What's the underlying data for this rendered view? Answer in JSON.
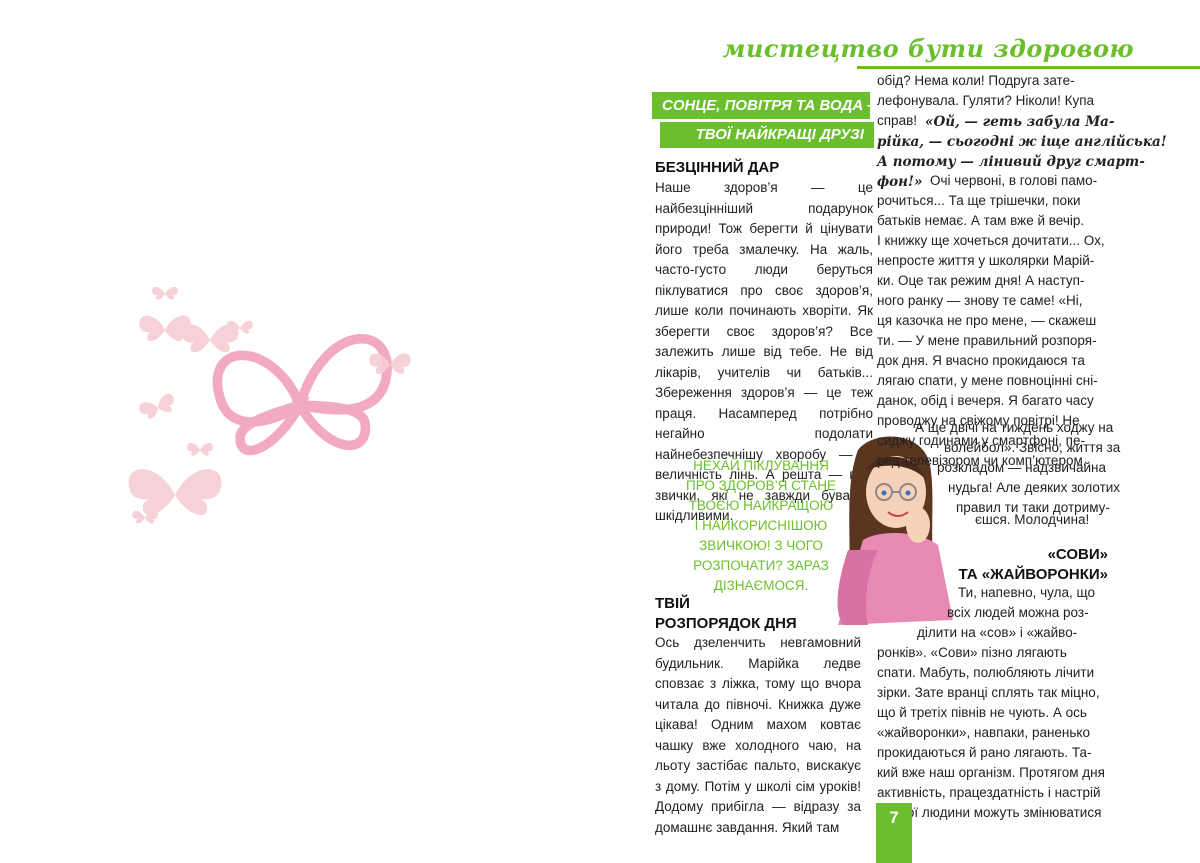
{
  "header": {
    "title": "мистецтво бути здоровою"
  },
  "banner": {
    "line1": "СОНЦЕ, ПОВІТРЯ ТА ВОДА —",
    "line2": "ТВОЇ НАЙКРАЩІ ДРУЗІ"
  },
  "section1": {
    "heading": "БЕЗЦІННИЙ ДАР",
    "text": "Наше здоров’я — це найбезцінніший подарунок природи! Тож берегти й цінувати його треба змалечку. На жаль, часто-густо люди беруться піклуватися про своє здоров’я, лише коли починають хворіти. Як зберегти своє здоров’я? Все залежить лише від тебе. Не від лікарів, учителів чи батьків... Збереження здоров’я — це теж праця. Насамперед потрібно негайно подолати найнебезпечнішу хворобу — її величність лінь. А решта — вже звички, які не завжди бувають шкідливими."
  },
  "callout": {
    "lines": [
      "НЕХАЙ ПІКЛУВАННЯ",
      "ПРО ЗДОРОВ’Я СТАНЕ",
      "ТВОЄЮ НАЙКРАЩОЮ",
      "І НАЙКОРИСНІШОЮ",
      "ЗВИЧКОЮ! З ЧОГО",
      "РОЗПОЧАТИ? ЗАРАЗ",
      "ДІЗНАЄМОСЯ."
    ]
  },
  "section2": {
    "heading_line1": "ТВІЙ",
    "heading_line2": "РОЗПОРЯДОК ДНЯ",
    "text": "Ось дзеленчить невгамовний будильник. Марійка ледве сповзає з ліжка, тому що вчора читала до півночі. Книжка дуже цікава! Одним махом ковтає чашку вже холодного чаю, на льоту застібає пальто, вискакує з дому. Потім у школі сім уроків! Додому прибігла — відразу за домашнє завдання. Який там"
  },
  "right_column": {
    "lines_top": [
      "обід? Нема коли! Подруга зате-",
      "лефонувала. Гуляти? Ніколи! Купа",
      "справ!"
    ],
    "quote_lines": [
      "«Ой, — геть забула Ма-",
      "рійка, — сьогодні ж іще англійська!",
      "А потому — лінивий друг смарт-",
      "фон!»"
    ],
    "after_quote": "Очі червоні, в голові памо-",
    "lines_mid": [
      "рочиться... Та ще трішечки, поки",
      "батьків немає. А там вже й вечір.",
      "І книжку ще хочеться дочитати... Ох,",
      "непросте життя у школярки Марій-",
      "ки. Оце так режим дня! А наступ-",
      "ного ранку — знову те саме! «Ні,",
      "ця казочка не про мене, — скажеш",
      "ти. — У мене правильний розпоря-",
      "док дня. Я вчасно прокидаюся та",
      "лягаю спати, у мене повноцінні сні-",
      "данок, обід і вечеря. Я багато часу",
      "проводжу на свіжому повітрі! Не",
      "сиджу годинами у смартфоні, пе-",
      "ред телевізором чи комп’ютером.",
      "А ще двічі на тиждень ходжу на",
      "волейбол». Звісно, життя за",
      "розкладом — надзвичайна",
      "нудьга! Але деяких золотих",
      "правил ти таки дотриму-",
      "єшся. Молодчина!"
    ],
    "heading_line1": "«СОВИ»",
    "heading_line2": "ТА «ЖАЙВОРОНКИ»",
    "lines_bottom": [
      "Ти, напевно, чула, що",
      "всіх людей можна роз-",
      "ділити на «сов» і «жайво-",
      "ронків». «Сови» пізно лягають",
      "спати. Мабуть, полюбляють лічити",
      "зірки. Зате вранці сплять так міцно,",
      "що й третіх півнів не чують. А ось",
      "«жайворонки», навпаки, раненько",
      "прокидаються й рано лягають. Та-",
      "кий вже наш організм. Протягом дня",
      "активність, працездатність і настрій",
      "кожної людини можуть змінюватися"
    ]
  },
  "page_number": "7",
  "colors": {
    "accent_green": "#6cbf2c",
    "butterfly_pink": "#f2b8c6"
  }
}
